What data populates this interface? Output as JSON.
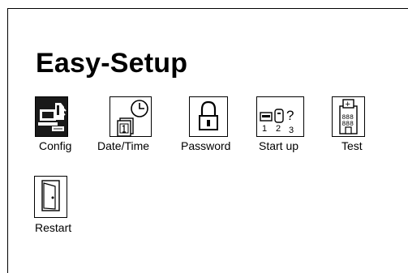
{
  "app": {
    "title": "Easy-Setup"
  },
  "icons": [
    {
      "id": "config",
      "label": "Config",
      "icon": "computer-setup-icon",
      "selected": true
    },
    {
      "id": "datetime",
      "label": "Date/Time",
      "icon": "calendar-clock-icon",
      "selected": false
    },
    {
      "id": "password",
      "label": "Password",
      "icon": "padlock-icon",
      "selected": false
    },
    {
      "id": "startup",
      "label": "Start up",
      "icon": "boot-sequence-icon",
      "selected": false,
      "digits": [
        "1",
        "2",
        "3"
      ],
      "question_mark": "?"
    },
    {
      "id": "test",
      "label": "Test",
      "icon": "hospital-diagnostics-icon",
      "selected": false,
      "cross": "+",
      "windows": "888"
    },
    {
      "id": "restart",
      "label": "Restart",
      "icon": "door-icon",
      "selected": false
    }
  ],
  "colors": {
    "background": "#ffffff",
    "foreground": "#000000",
    "selected_tile": "#1a1a1a"
  }
}
